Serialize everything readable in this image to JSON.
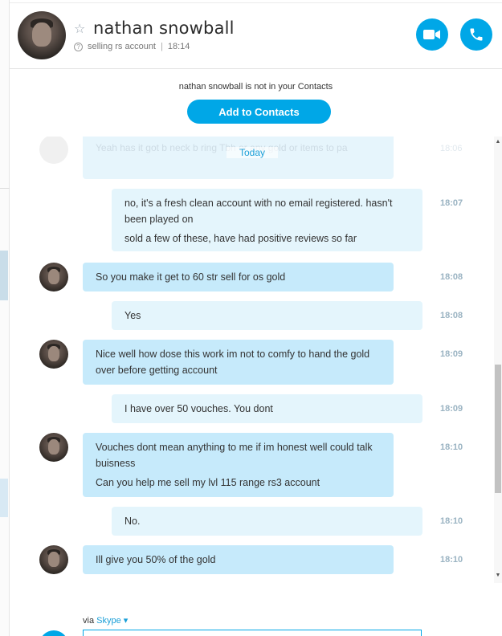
{
  "contact": {
    "name": "nathan snowball",
    "mood": "selling rs account",
    "separator": "|",
    "time": "18:14"
  },
  "notice": {
    "text": "nathan snowball is not in your Contacts",
    "add_button": "Add to Contacts"
  },
  "conversation": {
    "ghost_text": "Yeah has it got b neck b ring Tbh or any gold or items to pa",
    "ghost_time": "18:06",
    "date_label": "Today",
    "messages": [
      {
        "side": "out",
        "lines": [
          "no, it's a fresh clean account with no email registered. hasn't been played on",
          "sold a few of these, have had positive reviews so far"
        ],
        "time": "18:07"
      },
      {
        "side": "in",
        "lines": [
          "So you make it get to 60 str sell for os gold"
        ],
        "time": "18:08"
      },
      {
        "side": "out",
        "lines": [
          "Yes"
        ],
        "time": "18:08"
      },
      {
        "side": "in",
        "lines": [
          "Nice well how dose this work im not to comfy to hand the gold over before getting account"
        ],
        "time": "18:09"
      },
      {
        "side": "out",
        "lines": [
          "I have over 50 vouches. You dont"
        ],
        "time": "18:09"
      },
      {
        "side": "in",
        "lines": [
          "Vouches dont mean anything to me if im honest well could talk buisness",
          "Can you help me sell my lvl 115 range rs3 account"
        ],
        "time": "18:10"
      },
      {
        "side": "out",
        "lines": [
          "No."
        ],
        "time": "18:10"
      },
      {
        "side": "in",
        "lines": [
          "Ill give you 50% of the gold"
        ],
        "time": "18:10"
      }
    ]
  },
  "compose": {
    "via_label": "via",
    "via_service": "Skype",
    "caret": "▾"
  },
  "icons": {
    "favorite": "star-outline-icon",
    "mood_info": "question-mark-icon",
    "video": "video-camera-icon",
    "phone": "phone-icon"
  },
  "colors": {
    "accent": "#00a7e7",
    "incoming_bubble": "#c6eafb",
    "outgoing_bubble": "#e4f5fc",
    "timestamp": "#9ab3c2"
  }
}
